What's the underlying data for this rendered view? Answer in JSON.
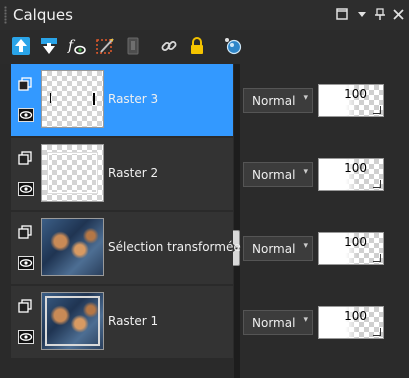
{
  "panel": {
    "title": "Calques",
    "title_buttons": [
      {
        "icon": "restore-icon",
        "glyph": "▢"
      },
      {
        "icon": "dropdown-icon",
        "glyph": "▾"
      },
      {
        "icon": "pin-icon",
        "glyph": "⊥"
      },
      {
        "icon": "close-icon",
        "glyph": "✕"
      }
    ]
  },
  "toolbar": {
    "tools": [
      {
        "icon": "new-raster-layer-icon"
      },
      {
        "icon": "new-layer-dropdown-icon"
      },
      {
        "icon": "layer-effects-icon"
      },
      {
        "icon": "edit-selection-icon"
      },
      {
        "icon": "mask-icon"
      },
      {
        "icon": "link-icon"
      },
      {
        "icon": "lock-icon"
      },
      {
        "icon": "properties-icon"
      }
    ]
  },
  "layers": [
    {
      "name": "Raster 3",
      "selected": true,
      "thumb": "raster3",
      "blend_mode": "Normal",
      "opacity": "100"
    },
    {
      "name": "Raster 2",
      "selected": false,
      "thumb": "raster2",
      "blend_mode": "Normal",
      "opacity": "100"
    },
    {
      "name": "Sélection transformée",
      "selected": false,
      "thumb": "photo",
      "blend_mode": "Normal",
      "opacity": "100"
    },
    {
      "name": "Raster 1",
      "selected": false,
      "thumb": "photo-framed",
      "blend_mode": "Normal",
      "opacity": "100"
    }
  ],
  "colors": {
    "selected": "#3399ff",
    "background": "#2b2b2b",
    "layer_row": "#333333"
  }
}
